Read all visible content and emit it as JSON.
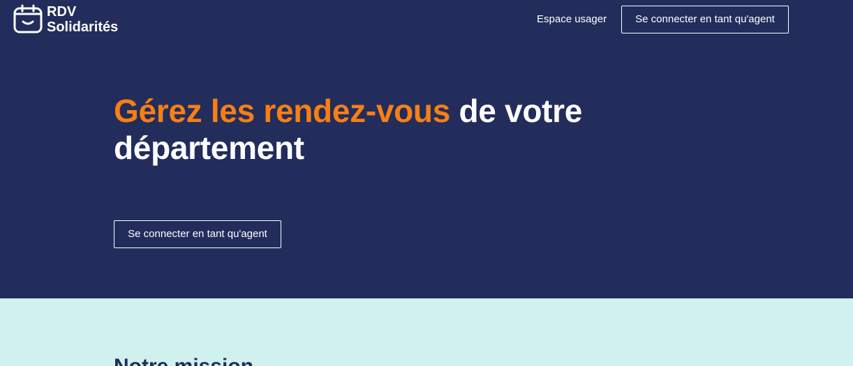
{
  "brand": {
    "name_line1": "RDV",
    "name_line2": "Solidarités",
    "icon": "calendar-smile-icon"
  },
  "header": {
    "nav_link": "Espace usager",
    "agent_button": "Se connecter en tant qu'agent"
  },
  "hero": {
    "headline_highlight": "Gérez les rendez-vous",
    "headline_rest": " de votre département",
    "cta_button": "Se connecter en tant qu'agent"
  },
  "mission": {
    "title": "Notre mission"
  },
  "colors": {
    "hero_background": "#222d5c",
    "accent": "#f77f14",
    "mission_background": "#cff2ef"
  }
}
